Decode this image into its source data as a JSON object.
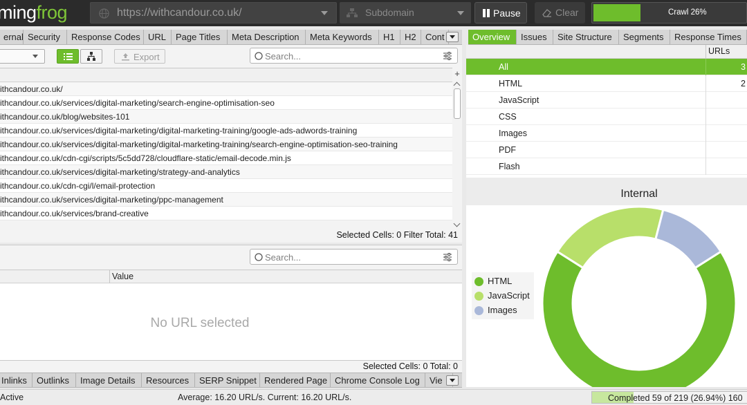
{
  "app": {
    "logo_white": "ming",
    "logo_green": "frog"
  },
  "topbar": {
    "url_value": "https://withcandour.co.uk/",
    "mode_label": "Subdomain",
    "pause_label": "Pause",
    "clear_label": "Clear",
    "crawl_label": "Crawl 26%",
    "crawl_progress": 0.26
  },
  "left_tabs": [
    {
      "label": "ernal"
    },
    {
      "label": "Security"
    },
    {
      "label": "Response Codes"
    },
    {
      "label": "URL"
    },
    {
      "label": "Page Titles"
    },
    {
      "label": "Meta Description"
    },
    {
      "label": "Meta Keywords"
    },
    {
      "label": "H1"
    },
    {
      "label": "H2"
    },
    {
      "label": "Cont"
    }
  ],
  "right_tabs": [
    {
      "label": "Overview",
      "active": true
    },
    {
      "label": "Issues"
    },
    {
      "label": "Site Structure"
    },
    {
      "label": "Segments"
    },
    {
      "label": "Response Times"
    }
  ],
  "toolbar": {
    "export_label": "Export",
    "search_placeholder": "Search..."
  },
  "url_rows": [
    "ithcandour.co.uk/",
    "ithcandour.co.uk/services/digital-marketing/search-engine-optimisation-seo",
    "ithcandour.co.uk/blog/websites-101",
    "ithcandour.co.uk/services/digital-marketing/digital-marketing-training/google-ads-adwords-training",
    "ithcandour.co.uk/services/digital-marketing/digital-marketing-training/search-engine-optimisation-seo-training",
    "ithcandour.co.uk/cdn-cgi/scripts/5c5dd728/cloudflare-static/email-decode.min.js",
    "ithcandour.co.uk/services/digital-marketing/strategy-and-analytics",
    "ithcandour.co.uk/cdn-cgi/l/email-protection",
    "ithcandour.co.uk/services/digital-marketing/ppc-management",
    "ithcandour.co.uk/services/brand-creative"
  ],
  "status_top": "Selected Cells:  0  Filter Total:  41",
  "lower": {
    "search_placeholder": "Search...",
    "value_header": "Value",
    "empty_message": "No URL selected",
    "status": "Selected Cells:  0  Total:  0"
  },
  "bottom_tabs": [
    {
      "label": "Inlinks"
    },
    {
      "label": "Outlinks"
    },
    {
      "label": "Image Details"
    },
    {
      "label": "Resources"
    },
    {
      "label": "SERP Snippet"
    },
    {
      "label": "Rendered Page"
    },
    {
      "label": "Chrome Console Log"
    },
    {
      "label": "Vie"
    }
  ],
  "overview": {
    "urls_header": "URLs",
    "rows": [
      {
        "name": "All",
        "count": "3",
        "active": true
      },
      {
        "name": "HTML",
        "count": "2"
      },
      {
        "name": "JavaScript",
        "count": ""
      },
      {
        "name": "CSS",
        "count": ""
      },
      {
        "name": "Images",
        "count": ""
      },
      {
        "name": "PDF",
        "count": ""
      },
      {
        "name": "Flash",
        "count": ""
      }
    ]
  },
  "chart_data": {
    "type": "pie",
    "title": "Internal",
    "categories": [
      "HTML",
      "JavaScript",
      "Images"
    ],
    "values": [
      68,
      20,
      12
    ],
    "colors": [
      "#6ebd2c",
      "#b8df6a",
      "#aab8d9"
    ],
    "legend_position": "left"
  },
  "status_bar": {
    "left": "Active",
    "middle": "Average: 16.20 URL/s. Current: 16.20 URL/s.",
    "right": "Completed 59 of 219 (26.94%) 160",
    "progress": 0.2694
  }
}
